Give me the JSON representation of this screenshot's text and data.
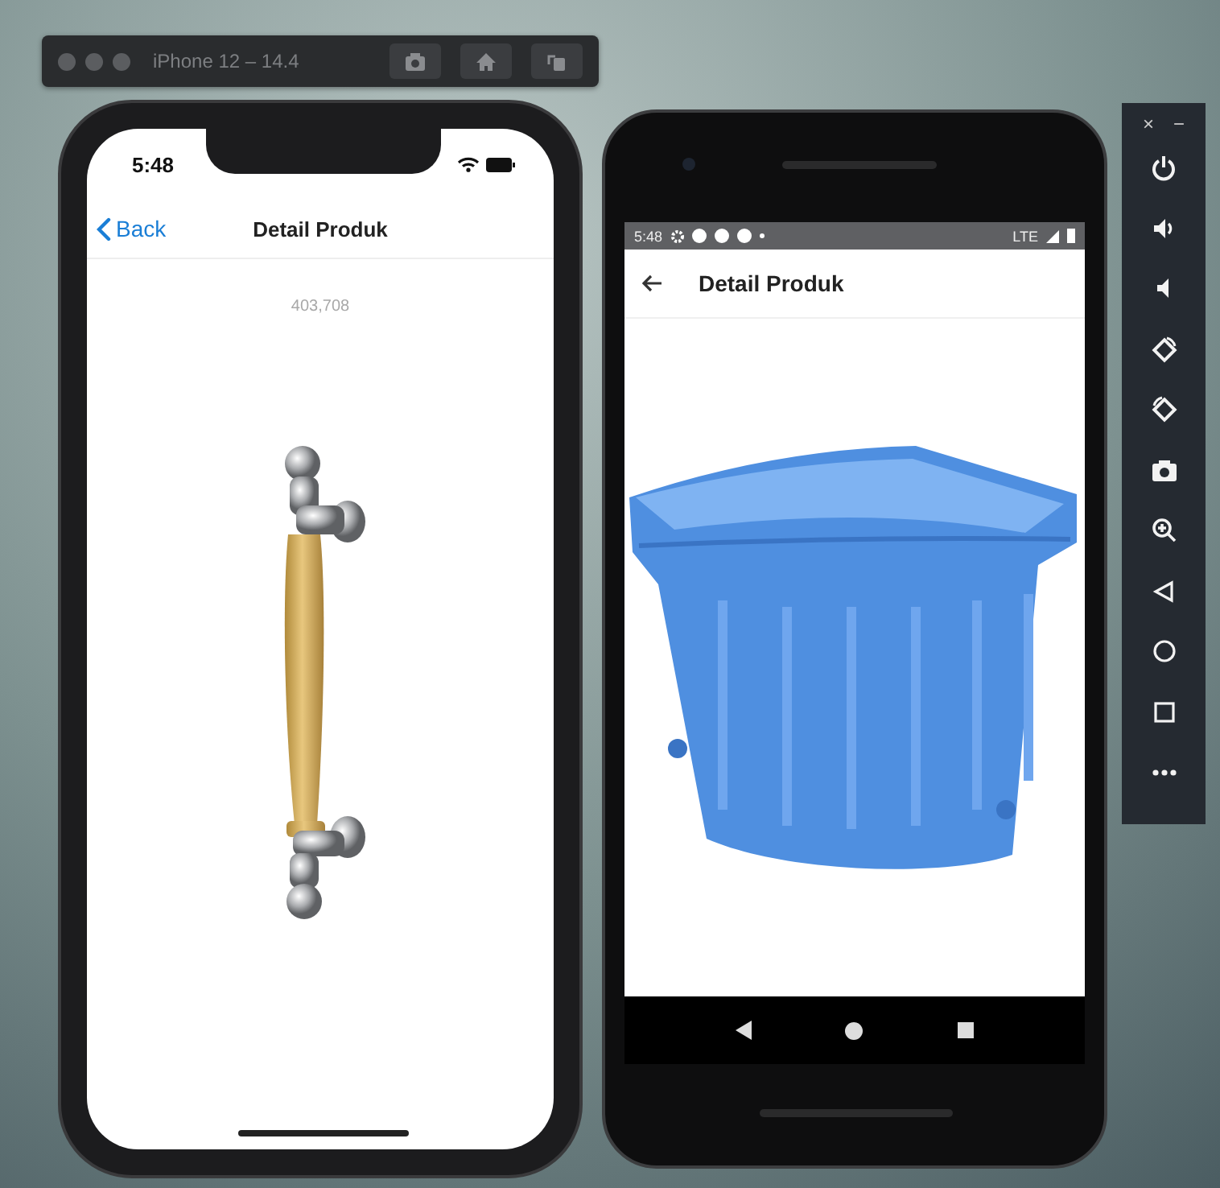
{
  "simulator_window": {
    "title": "iPhone 12 – 14.4"
  },
  "iphone": {
    "status_time": "5:48",
    "back_label": "Back",
    "title": "Detail Produk",
    "image_counter": "403,708"
  },
  "android": {
    "status_time": "5:48",
    "network": "LTE",
    "title": "Detail Produk"
  },
  "emulator_toolbar": {
    "close": "×",
    "minimize": "−"
  }
}
